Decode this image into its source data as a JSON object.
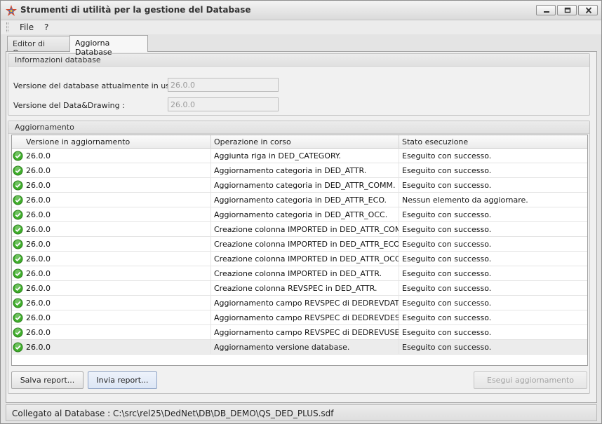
{
  "window": {
    "title": "Strumenti di utilità per la gestione del Database"
  },
  "menu": {
    "file": "File",
    "help": "?"
  },
  "tabs": [
    {
      "label": "Editor di Query",
      "active": false
    },
    {
      "label": "Aggiorna Database",
      "active": true
    }
  ],
  "info_group": {
    "title": "Informazioni database",
    "db_version_label": "Versione del database attualmente in uso :",
    "db_version_value": "26.0.0",
    "dd_version_label": "Versione del Data&Drawing :",
    "dd_version_value": "26.0.0"
  },
  "update_group": {
    "title": "Aggiornamento",
    "columns": [
      "Versione in aggiornamento",
      "Operazione in corso",
      "Stato esecuzione"
    ],
    "rows": [
      {
        "version": "26.0.0",
        "operation": "Aggiunta riga in DED_CATEGORY.",
        "status": "Eseguito con successo."
      },
      {
        "version": "26.0.0",
        "operation": "Aggiornamento categoria in DED_ATTR.",
        "status": "Eseguito con successo."
      },
      {
        "version": "26.0.0",
        "operation": "Aggiornamento categoria in DED_ATTR_COMM.",
        "status": "Eseguito con successo."
      },
      {
        "version": "26.0.0",
        "operation": "Aggiornamento categoria in DED_ATTR_ECO.",
        "status": "Nessun elemento da aggiornare."
      },
      {
        "version": "26.0.0",
        "operation": "Aggiornamento categoria in DED_ATTR_OCC.",
        "status": "Eseguito con successo."
      },
      {
        "version": "26.0.0",
        "operation": "Creazione colonna IMPORTED in DED_ATTR_COMM.",
        "status": "Eseguito con successo."
      },
      {
        "version": "26.0.0",
        "operation": "Creazione colonna IMPORTED in DED_ATTR_ECO.",
        "status": "Eseguito con successo."
      },
      {
        "version": "26.0.0",
        "operation": "Creazione colonna IMPORTED in DED_ATTR_OCC.",
        "status": "Eseguito con successo."
      },
      {
        "version": "26.0.0",
        "operation": "Creazione colonna IMPORTED in DED_ATTR.",
        "status": "Eseguito con successo."
      },
      {
        "version": "26.0.0",
        "operation": "Creazione colonna REVSPEC in DED_ATTR.",
        "status": "Eseguito con successo."
      },
      {
        "version": "26.0.0",
        "operation": "Aggiornamento campo REVSPEC di DEDREVDATE.",
        "status": "Eseguito con successo."
      },
      {
        "version": "26.0.0",
        "operation": "Aggiornamento campo REVSPEC di DEDREVDESC.",
        "status": "Eseguito con successo."
      },
      {
        "version": "26.0.0",
        "operation": "Aggiornamento campo REVSPEC di DEDREVUSER.",
        "status": "Eseguito con successo."
      },
      {
        "version": "26.0.0",
        "operation": "Aggiornamento versione database.",
        "status": "Eseguito con successo."
      }
    ],
    "selected_row": 13
  },
  "buttons": {
    "save_report": "Salva report...",
    "send_report": "Invia report...",
    "run_update": "Esegui aggiornamento"
  },
  "status": {
    "text": "Collegato al Database : C:\\src\\rel25\\DedNet\\DB\\DB_DEMO\\QS_DED_PLUS.sdf"
  },
  "icons": {
    "app": "app-star-icon",
    "row_status": "check-circle-icon"
  },
  "colors": {
    "success_green": "#3fae2a"
  }
}
